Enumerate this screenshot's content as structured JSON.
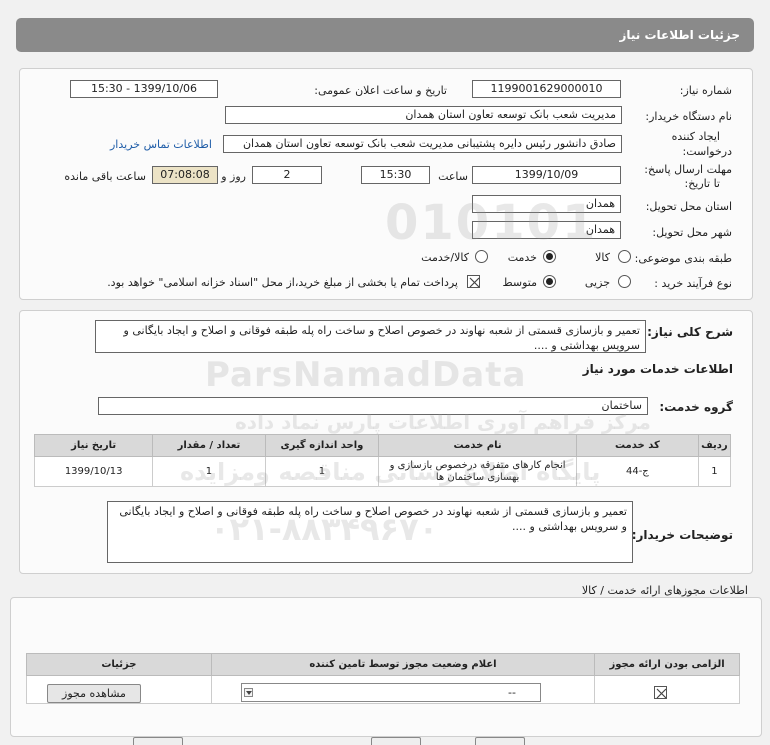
{
  "header": {
    "title": "جزئیات اطلاعات نیاز"
  },
  "form": {
    "need_number_label": "شماره نیاز:",
    "need_number": "1199001629000010",
    "announce_label": "تاریخ و ساعت اعلان عمومی:",
    "announce_value": "1399/10/06 - 15:30",
    "buyer_org_label": "نام دستگاه خریدار:",
    "buyer_org": "مدیریت شعب بانک توسعه تعاون استان همدان",
    "creator_label_1": "ایجاد کننده",
    "creator_label_2": "درخواست:",
    "creator": "صادق دانشور رئیس دایره پشتیبانی مدیریت شعب بانک توسعه تعاون استان همدان",
    "contact_link": "اطلاعات تماس خریدار",
    "deadline_label_1": "مهلت ارسال پاسخ:",
    "deadline_label_2": "تا تاریخ:",
    "deadline_date": "1399/10/09",
    "time_label": "ساعت",
    "deadline_time": "15:30",
    "days_value": "2",
    "days_label": "روز و",
    "remaining_time": "07:08:08",
    "remaining_label": "ساعت باقی مانده",
    "province_label": "استان محل تحویل:",
    "province": "همدان",
    "city_label": "شهر محل تحویل:",
    "city": "همدان",
    "category_label": "طبقه بندی موضوعی:",
    "category_options": [
      "کالا",
      "خدمت",
      "کالا/خدمت"
    ],
    "category_selected": "خدمت",
    "process_label": "نوع فرآیند خرید :",
    "process_options": [
      "جزیی",
      "متوسط"
    ],
    "process_selected": "متوسط",
    "payment_note": "پرداخت تمام یا بخشی از مبلغ خرید،از محل \"اسناد خزانه اسلامی\" خواهد بود."
  },
  "summary": {
    "description_label": "شرح کلی نیاز:",
    "description": "تعمیر و بازسازی قسمتی از شعبه نهاوند در خصوص اصلاح و ساخت راه پله طبقه فوقانی و اصلاح و ایجاد بایگانی و سرویس بهداشتی و ....",
    "services_title": "اطلاعات خدمات مورد نیاز",
    "service_group_label": "گروه خدمت:",
    "service_group": "ساختمان",
    "table": {
      "headers": [
        "ردیف",
        "کد خدمت",
        "نام خدمت",
        "واحد اندازه گیری",
        "تعداد / مقدار",
        "تاریخ نیاز"
      ],
      "rows": [
        [
          "1",
          "ج-44",
          "انجام کارهای متفرقه درخصوص بازسازی و بهسازی ساختمان ها",
          "1",
          "1",
          "1399/10/13"
        ]
      ]
    },
    "buyer_notes_label": "توضیحات خریدار:",
    "buyer_notes": "تعمیر و بازسازی قسمتی از شعبه نهاوند در خصوص اصلاح و ساخت راه پله طبقه فوقانی و اصلاح و ایجاد بایگانی و سرویس بهداشتی و ...."
  },
  "permits": {
    "title": "اطلاعات مجوزهای ارائه خدمت / کالا",
    "headers": [
      "الزامی بودن ارائه مجوز",
      "اعلام وضعیت مجوز توسط تامین کننده",
      "جزئیات"
    ],
    "status_value": "--",
    "view_button": "مشاهده مجوز"
  },
  "watermark": {
    "digits": "010101",
    "brand": "ParsNamadData",
    "fa_line1": "مرکز فراهم آوری اطلاعات پارس نماد داده",
    "fa_line2": "پایگاه اطلاع رسانی مناقصه ومزایده",
    "phone": "۰۲۱-۸۸۳۴۹۶۷۰"
  }
}
